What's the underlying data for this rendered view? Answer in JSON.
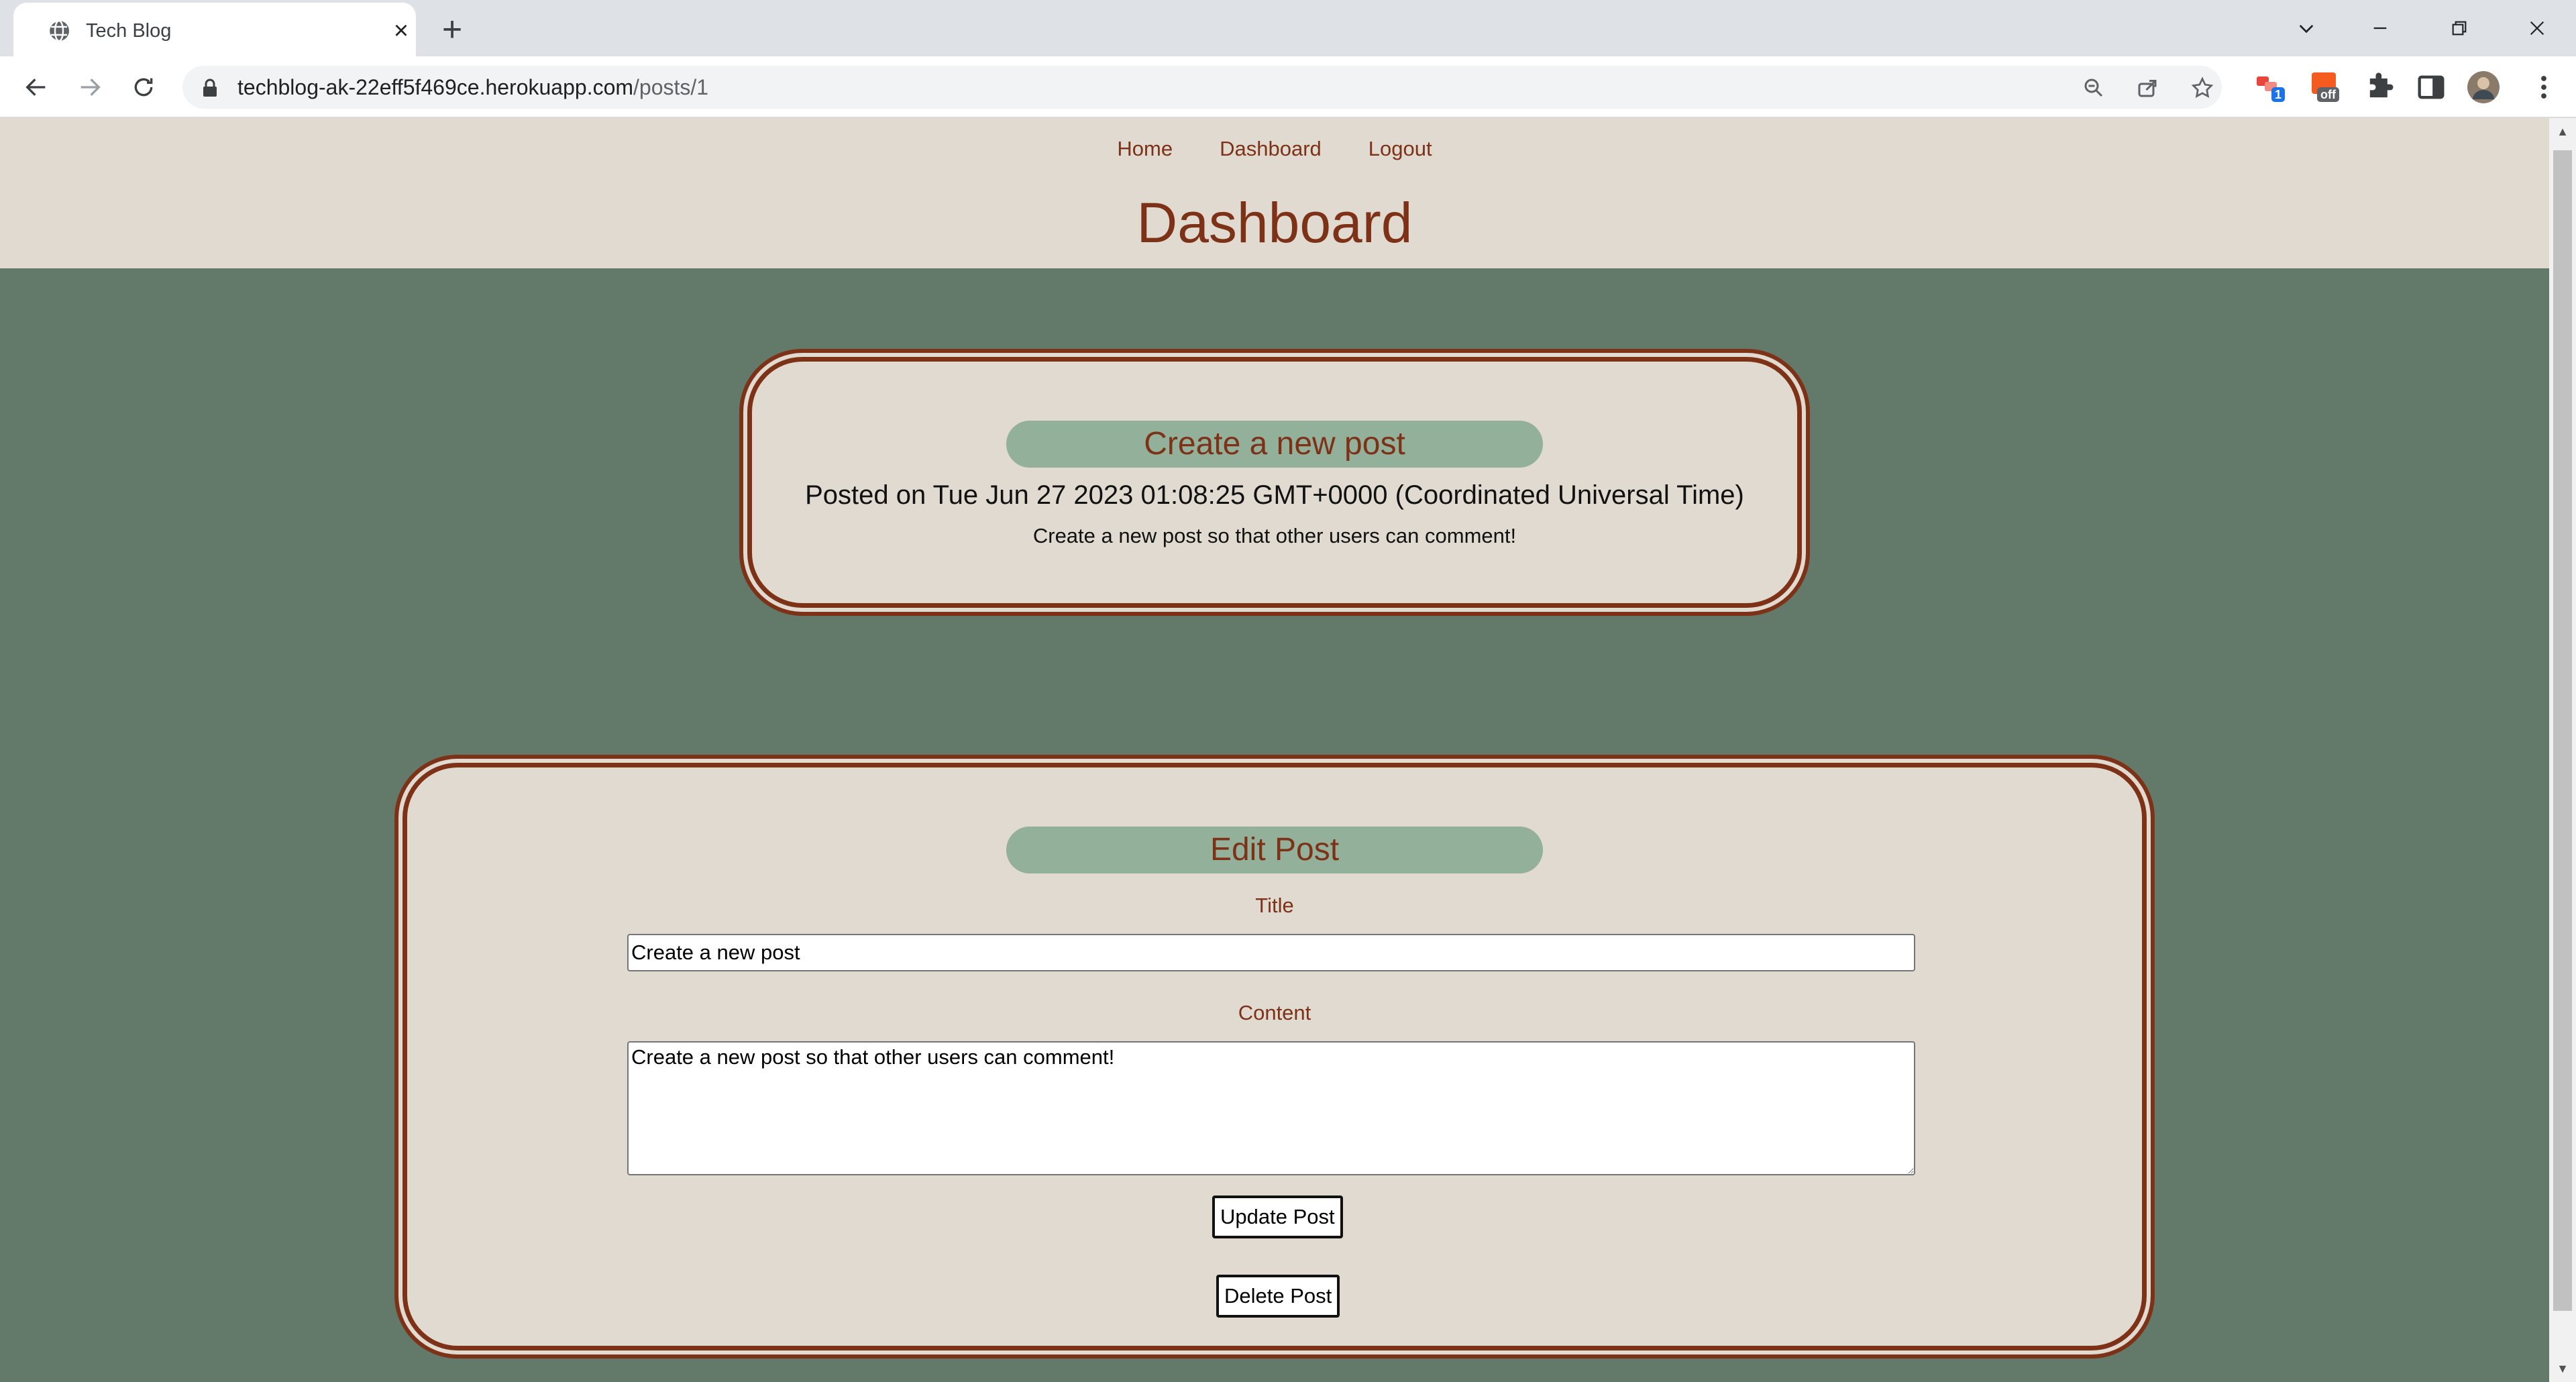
{
  "browser": {
    "tab_title": "Tech Blog",
    "url_host": "techblog-ak-22eff5f469ce.herokuapp.com",
    "url_path": "/posts/1",
    "extension_badge_count": "1",
    "extension_badge_off": "off"
  },
  "nav": {
    "home": "Home",
    "dashboard": "Dashboard",
    "logout": "Logout"
  },
  "page_title": "Dashboard",
  "post": {
    "title": "Create a new post",
    "posted_on": "Posted on Tue Jun 27 2023 01:08:25 GMT+0000 (Coordinated Universal Time)",
    "content": "Create a new post so that other users can comment!"
  },
  "edit_form": {
    "heading": "Edit Post",
    "title_label": "Title",
    "title_value": "Create a new post",
    "content_label": "Content",
    "content_value": "Create a new post so that other users can comment!",
    "update_button": "Update Post",
    "delete_button": "Delete Post"
  },
  "colors": {
    "brand_brown": "#7d3218",
    "background_green": "#637a6a",
    "card_beige": "#e0dad0",
    "pill_green": "#92b09a"
  }
}
